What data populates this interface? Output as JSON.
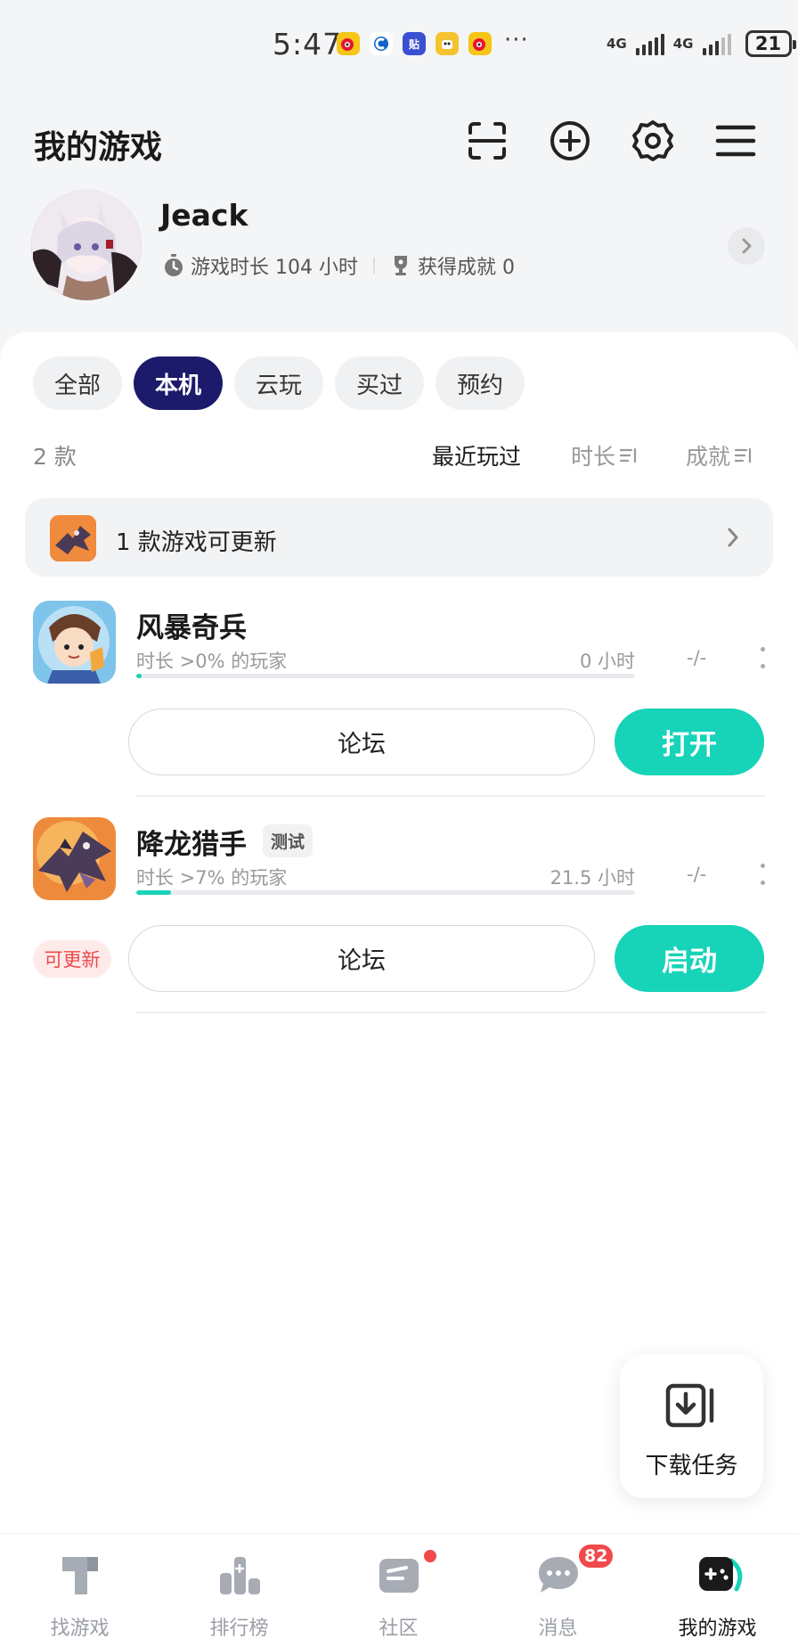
{
  "status_bar": {
    "time": "5:47",
    "dots": "···",
    "network_1": "4G",
    "network_2": "4G",
    "battery": "21"
  },
  "header": {
    "title": "我的游戏"
  },
  "profile": {
    "username": "Jeack",
    "play_time": "游戏时长 104 小时",
    "achievements": "获得成就 0"
  },
  "filter_tabs": [
    {
      "label": "全部",
      "active": false
    },
    {
      "label": "本机",
      "active": true
    },
    {
      "label": "云玩",
      "active": false
    },
    {
      "label": "买过",
      "active": false
    },
    {
      "label": "预约",
      "active": false
    }
  ],
  "sort": {
    "count": "2 款",
    "recent": "最近玩过",
    "duration": "时长",
    "achievement": "成就"
  },
  "update_banner": {
    "text": "1 款游戏可更新"
  },
  "games": [
    {
      "name": "风暴奇兵",
      "tag": "",
      "meta": "时长 >0% 的玩家",
      "hours": "0 小时",
      "achievement": "-/-",
      "progress": 0.01,
      "forum_label": "论坛",
      "action_label": "打开",
      "update_label": ""
    },
    {
      "name": "降龙猎手",
      "tag": "测试",
      "meta": "时长 >7% 的玩家",
      "hours": "21.5 小时",
      "achievement": "-/-",
      "progress": 0.07,
      "forum_label": "论坛",
      "action_label": "启动",
      "update_label": "可更新"
    }
  ],
  "download_task": {
    "label": "下载任务"
  },
  "bottom_nav": [
    {
      "label": "找游戏",
      "active": false
    },
    {
      "label": "排行榜",
      "active": false
    },
    {
      "label": "社区",
      "active": false
    },
    {
      "label": "消息",
      "active": false,
      "badge": "82"
    },
    {
      "label": "我的游戏",
      "active": true
    }
  ],
  "colors": {
    "accent": "#17d3b8",
    "active_tab": "#1c1a6b",
    "badge_red": "#f2494b",
    "update_red": "#ec4b4b"
  }
}
